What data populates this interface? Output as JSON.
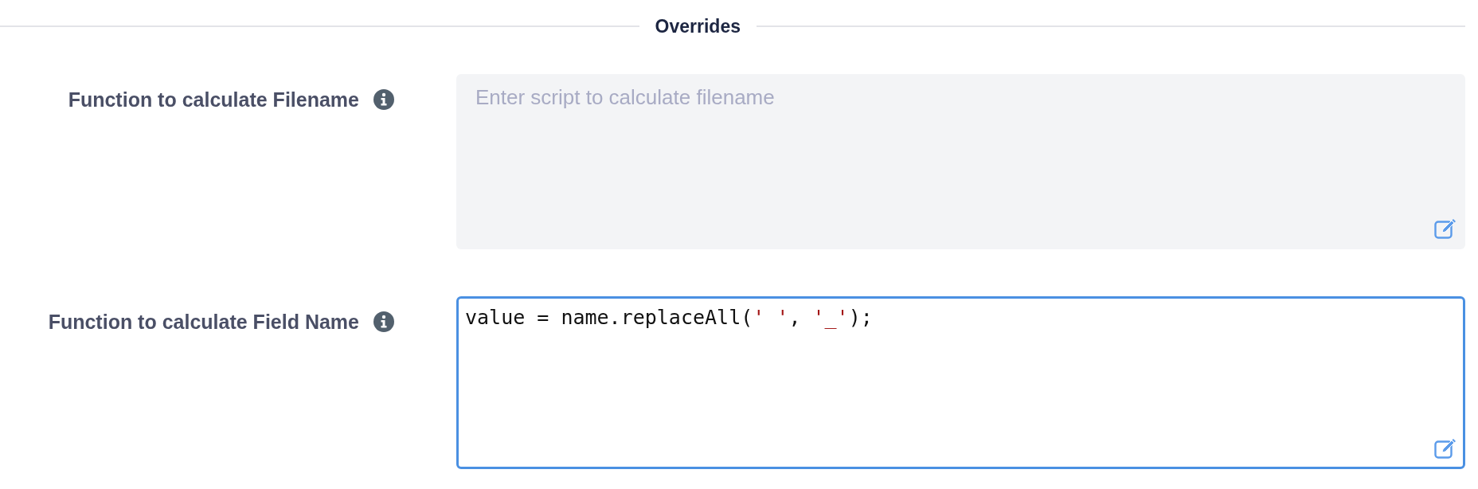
{
  "section": {
    "title": "Overrides"
  },
  "fields": [
    {
      "label": "Function to calculate Filename",
      "placeholder": "Enter script to calculate filename",
      "focused": false
    },
    {
      "label": "Function to calculate Field Name",
      "value": "value = name.replaceAll(' ', '_');",
      "focused": true
    }
  ]
}
